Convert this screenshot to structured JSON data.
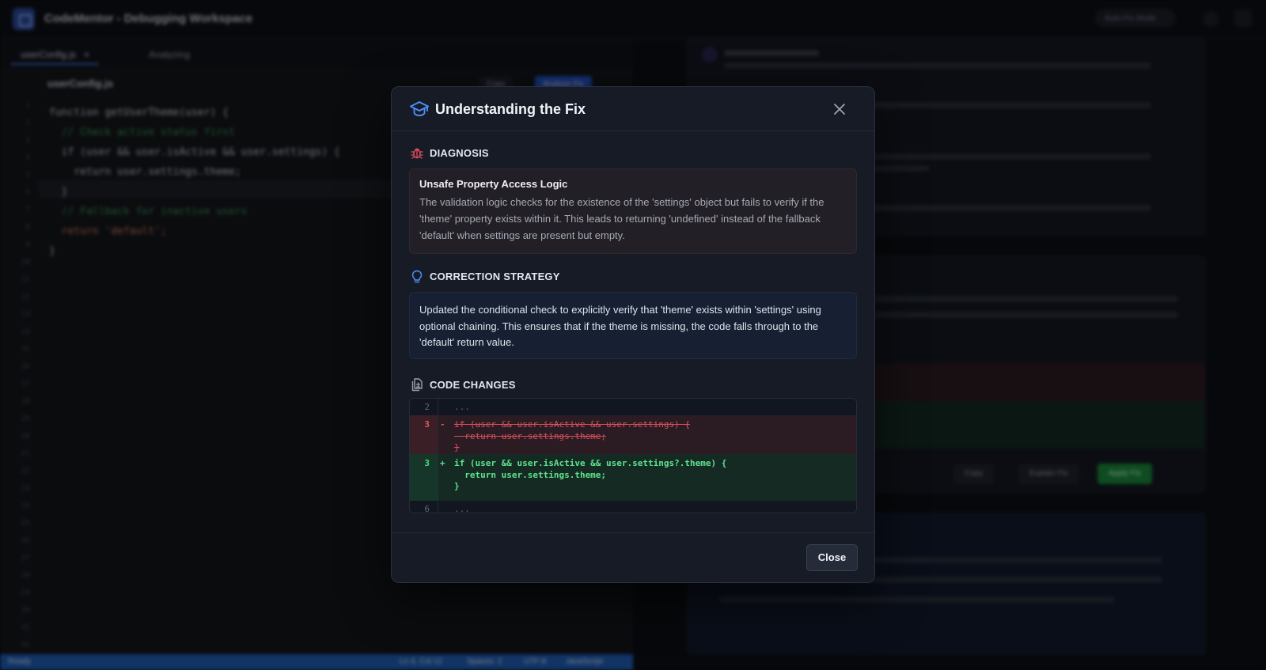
{
  "app": {
    "title": "CodeMentor - Debugging Workspace",
    "top_pill": "Auto-Fix Mode",
    "file_tab": "userConfig.js",
    "secondary_tab": "Analyzing",
    "breadcrumb": "userConfig.js",
    "copy_label": "Copy",
    "analyze_label": "Analyze Fix",
    "status_left": "Ready",
    "status_right": [
      "Ln 4, Col 12",
      "Spaces: 2",
      "UTF-8",
      "JavaScript"
    ],
    "code_bg": [
      "function getUserTheme(user) {",
      "  // Check active status first",
      "  if (user && user.isActive && user.settings) {",
      "    return user.settings.theme;",
      "  }",
      "  // Fallback for inactive users",
      "  return 'default';",
      "}"
    ],
    "right_buttons": [
      "Copy",
      "Explain Fix",
      "Apply Fix"
    ]
  },
  "modal": {
    "title": "Understanding the Fix",
    "icons": {
      "header": "graduation-cap-icon",
      "diagnosis": "bug-icon",
      "strategy": "lightbulb-icon",
      "changes": "file-diff-icon",
      "close": "close-icon"
    },
    "colors": {
      "accent": "#3b82f6",
      "diagnosis": "#e0505e",
      "added": "#4ade80",
      "removed": "#e05a68"
    },
    "diagnosis": {
      "label": "DIAGNOSIS",
      "heading": "Unsafe Property Access Logic",
      "text": "The validation logic checks for the existence of the 'settings' object but fails to verify if the 'theme' property exists within it. This leads to returning 'undefined' instead of the fallback 'default' when settings are present but empty."
    },
    "strategy": {
      "label": "CORRECTION STRATEGY",
      "text": "Updated the conditional check to explicitly verify that 'theme' exists within 'settings' using optional chaining. This ensures that if the theme is missing, the code falls through to the 'default' return value."
    },
    "changes": {
      "label": "CODE CHANGES",
      "rows": [
        {
          "type": "ctx",
          "num": "2",
          "sign": "",
          "lines": [
            "..."
          ]
        },
        {
          "type": "del",
          "num": "3",
          "sign": "-",
          "lines": [
            "if (user && user.isActive && user.settings) {",
            "  return user.settings.theme;",
            "}"
          ]
        },
        {
          "type": "add",
          "num": "3",
          "sign": "+",
          "lines": [
            "if (user && user.isActive && user.settings?.theme) {",
            "  return user.settings.theme;",
            "}"
          ]
        },
        {
          "type": "ctx",
          "num": "6",
          "sign": "",
          "lines": [
            "..."
          ]
        }
      ]
    },
    "footer": {
      "close_label": "Close"
    }
  }
}
